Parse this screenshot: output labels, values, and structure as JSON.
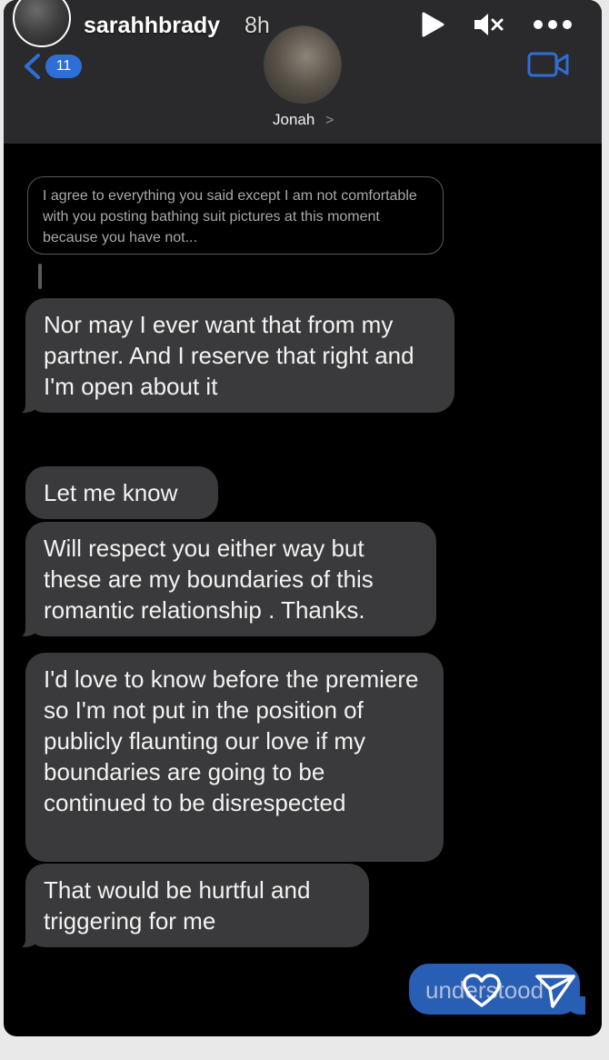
{
  "story": {
    "username": "sarahhbrady",
    "time": "8h",
    "icons": {
      "play": "play-icon",
      "mute": "speaker-muted-icon",
      "more": "more-dots-icon"
    }
  },
  "chat_header": {
    "back_count": "11",
    "contact_name": "Jonah",
    "contact_chevron": ">",
    "icons": {
      "back": "chevron-left-icon",
      "video": "video-camera-icon"
    },
    "accent_color": "#2d6fd6"
  },
  "reply_quote": {
    "text": "I agree to everything you said except I am not comfortable with you posting bathing suit pictures at this moment because you have not..."
  },
  "messages": [
    {
      "text": "Nor may I ever want that from my partner. And I reserve that right and I'm open about it"
    },
    {
      "text": "Let me know"
    },
    {
      "text": "Will respect you either way but these are my boundaries of this romantic relationship . Thanks."
    },
    {
      "text": "I'd love to know before the premiere so I'm not put in the position of publicly flaunting our love if my boundaries are going to be continued to be disrespected"
    },
    {
      "text": "That would be hurtful and triggering for me"
    }
  ],
  "sent_message": {
    "text": "understood"
  },
  "footer_icons": {
    "heart": "heart-outline-icon",
    "send": "paper-plane-icon"
  },
  "colors": {
    "received_bubble": "#3a3a3c",
    "sent_bubble": "#2f6fd4",
    "background": "#000000"
  }
}
